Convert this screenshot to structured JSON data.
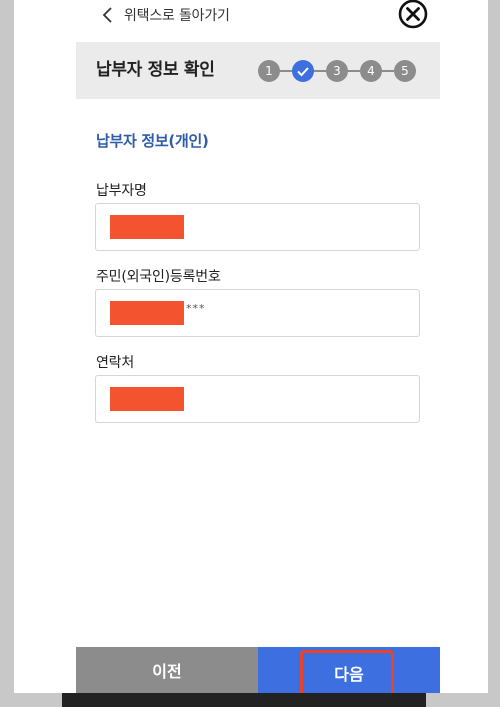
{
  "topbar": {
    "back_label": "위택스로 돌아가기",
    "back_icon": "chevron-left-icon",
    "close_icon": "close-circle-icon"
  },
  "header": {
    "title": "납부자 정보 확인",
    "steps": [
      {
        "label": "1",
        "state": "inactive"
      },
      {
        "label": "",
        "state": "active",
        "icon": "check-icon"
      },
      {
        "label": "3",
        "state": "inactive"
      },
      {
        "label": "4",
        "state": "inactive"
      },
      {
        "label": "5",
        "state": "inactive"
      }
    ]
  },
  "section": {
    "title": "납부자 정보(개인)"
  },
  "fields": [
    {
      "label": "납부자명",
      "value_redacted": true,
      "suffix": ""
    },
    {
      "label": "주민(외국인)등록번호",
      "value_redacted": true,
      "suffix": "***"
    },
    {
      "label": "연락처",
      "value_redacted": true,
      "suffix": ""
    }
  ],
  "buttons": {
    "prev_label": "이전",
    "next_label": "다음"
  },
  "colors": {
    "accent": "#3d6fe0",
    "section_title": "#2f5ca8",
    "redaction": "#f4532f",
    "highlight": "#e8442a",
    "inactive": "#8c8c8c"
  }
}
